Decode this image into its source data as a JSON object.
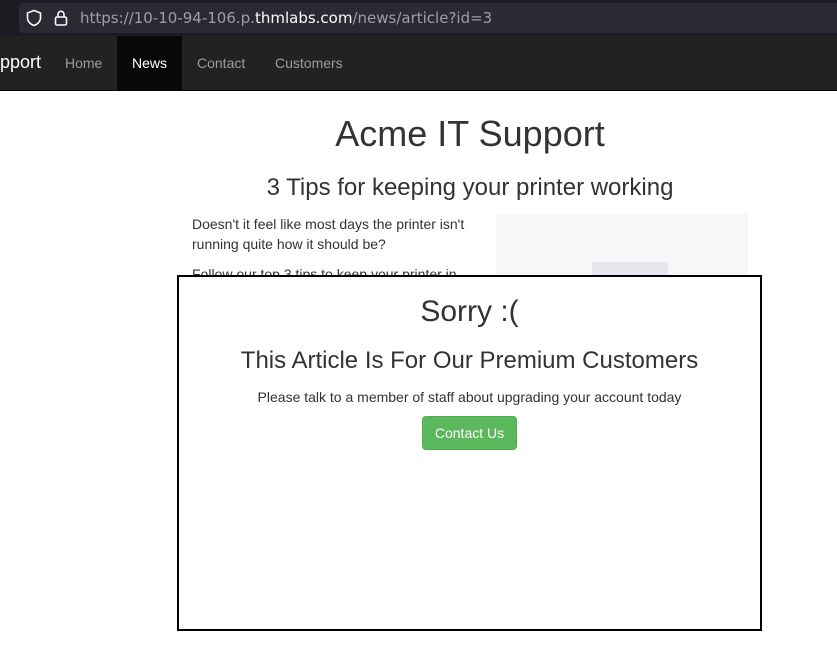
{
  "browser": {
    "url_prefix": "https://10-10-94-106.p.",
    "url_host": "thmlabs.com",
    "url_path": "/news/article?id=3"
  },
  "navbar": {
    "brand": "pport",
    "items": [
      {
        "label": "Home"
      },
      {
        "label": "News",
        "active": true
      },
      {
        "label": "Contact"
      },
      {
        "label": "Customers"
      }
    ]
  },
  "page": {
    "site_title": "Acme IT Support",
    "article_title": "3 Tips for keeping your printer working",
    "paragraphs": [
      "Doesn't it feel like most days the printer isn't running quite how it should be?",
      "Follow our top 3 tips to keep your printer in"
    ]
  },
  "modal": {
    "heading": "Sorry :(",
    "subheading": "This Article Is For Our Premium Customers",
    "message": "Please talk to a member of staff about upgrading your account today",
    "button_label": "Contact Us"
  },
  "colors": {
    "navbar_bg": "#222222",
    "nav_active_bg": "#080808",
    "button_green": "#5cb85c"
  }
}
